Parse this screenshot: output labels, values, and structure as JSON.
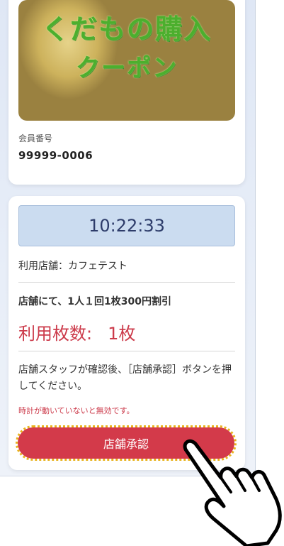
{
  "banner": {
    "title_line1": "くだもの購入",
    "title_line2": "クーポン"
  },
  "member": {
    "label": "会員番号",
    "number": "99999-0006"
  },
  "coupon": {
    "clock": "10:22:33",
    "store": "利用店舗：カフェテスト",
    "discount": "店舗にて、1人１回1枚300円割引",
    "usage_label": "利用枚数:",
    "usage_value": "1枚",
    "instruction": "店舗スタッフが確認後、［店舗承認］ボタンを押してください。",
    "warning": "時計が動いていないと無効です。",
    "approve_label": "店舗承認"
  },
  "icons": {
    "hand": "pointing-hand-icon"
  }
}
